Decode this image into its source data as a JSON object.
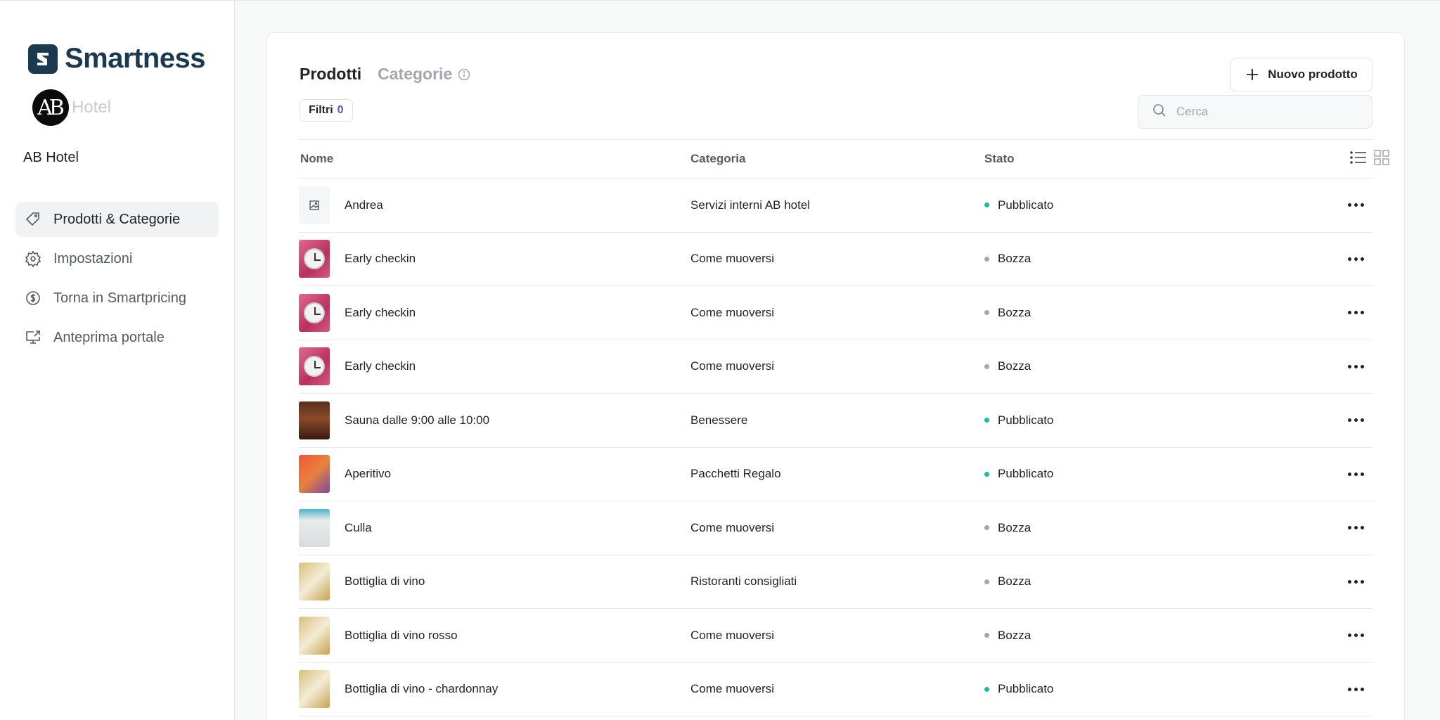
{
  "sidebar": {
    "brand_name": "Smartness",
    "hotel_logo_initials": "AB",
    "hotel_logo_word": "Hotel",
    "property_name": "AB Hotel",
    "items": [
      {
        "label": "Prodotti & Categorie",
        "icon": "tag-icon",
        "active": true
      },
      {
        "label": "Impostazioni",
        "icon": "gear-icon",
        "active": false
      },
      {
        "label": "Torna in Smartpricing",
        "icon": "dollar-circle-icon",
        "active": false
      },
      {
        "label": "Anteprima portale",
        "icon": "monitor-external-icon",
        "active": false
      }
    ]
  },
  "main": {
    "tabs": [
      {
        "label": "Prodotti",
        "active": true
      },
      {
        "label": "Categorie",
        "active": false
      }
    ],
    "new_button_label": "Nuovo prodotto",
    "filter_label": "Filtri",
    "filter_count": "0",
    "search_placeholder": "Cerca",
    "table": {
      "columns": [
        "Nome",
        "Categoria",
        "Stato"
      ],
      "rows": [
        {
          "name": "Andrea",
          "category": "Servizi interni AB hotel",
          "state": "Pubblicato",
          "thumb": "image-placeholder-icon"
        },
        {
          "name": "Early checkin",
          "category": "Come muoversi",
          "state": "Bozza",
          "thumb": "alarm-clock"
        },
        {
          "name": "Early checkin",
          "category": "Come muoversi",
          "state": "Bozza",
          "thumb": "alarm-clock"
        },
        {
          "name": "Early checkin",
          "category": "Come muoversi",
          "state": "Bozza",
          "thumb": "alarm-clock"
        },
        {
          "name": "Sauna dalle 9:00 alle 10:00",
          "category": "Benessere",
          "state": "Pubblicato",
          "thumb": "sauna"
        },
        {
          "name": "Aperitivo",
          "category": "Pacchetti Regalo",
          "state": "Pubblicato",
          "thumb": "aperitivo"
        },
        {
          "name": "Culla",
          "category": "Come muoversi",
          "state": "Bozza",
          "thumb": "culla"
        },
        {
          "name": "Bottiglia di vino",
          "category": "Ristoranti consigliati",
          "state": "Bozza",
          "thumb": "vino"
        },
        {
          "name": "Bottiglia di vino rosso",
          "category": "Come muoversi",
          "state": "Bozza",
          "thumb": "vino"
        },
        {
          "name": "Bottiglia di vino - chardonnay",
          "category": "Come muoversi",
          "state": "Pubblicato",
          "thumb": "vino"
        }
      ]
    }
  },
  "colors": {
    "brand": "#1c3a4f",
    "published_dot": "#1fb8a0",
    "draft_dot": "#a3a8ae",
    "filter_count": "#5b4bd6"
  }
}
